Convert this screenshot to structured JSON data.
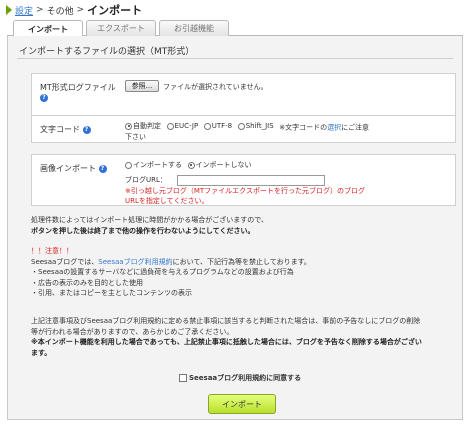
{
  "breadcrumb": {
    "settings": "設定",
    "sep1": ">",
    "other": "その他",
    "sep2": ">",
    "current": "インポート"
  },
  "tabs": [
    {
      "label": "インポート",
      "active": true
    },
    {
      "label": "エクスポート",
      "active": false
    },
    {
      "label": "お引越機能",
      "active": false
    }
  ],
  "section": {
    "title": "インポートするファイルの選択（MT形式）"
  },
  "rows": {
    "mt_log": {
      "label": "MT形式ログファイル",
      "button": "参照...",
      "status": "ファイルが選択されていません。"
    },
    "charset": {
      "label": "文字コード",
      "options": [
        "自動判定",
        "EUC-JP",
        "UTF-8",
        "Shift_JIS"
      ],
      "selected": "自動判定",
      "note_pre": "※文字コードの",
      "note_link": "選択",
      "note_post": "にご注意",
      "note_line2": "下さい"
    },
    "image_import": {
      "label": "画像インポート",
      "options": [
        "インポートする",
        "インポートしない"
      ],
      "selected": "インポートしない",
      "blog_url_label": "ブログURL：",
      "blog_url_value": "",
      "warn_line1": "※引っ越し元ブログ（MTファイルエクスポートを行った元ブログ）のブログ",
      "warn_line2": "URLを指定してください。"
    }
  },
  "notices": {
    "processing_line1": "処理件数によってはインポート処理に時間がかかる場合がございますので、",
    "processing_line2": "ボタンを押した後は終了まで他の操作を行わないようにしてください。",
    "caution_head": "！！注意！！",
    "seesaa_pre": "Seesaaブログでは、",
    "seesaa_link": "Seesaaブログ利用規約",
    "seesaa_post": "において、下記行為等を禁止しております。",
    "bullet1": "・Seesaaの設置するサーバなどに過負荷を与えるプログラムなどの設置および行為",
    "bullet2": "・広告の表示のみを目的とした使用",
    "bullet3": "・引用、またはコピーを主としたコンテンツの表示",
    "terms_line1": "上記注意事項及びSeesaaブログ利用規約に定める禁止事項に該当すると判断された場合は、事前の予告なしにブログの削除",
    "terms_line2": "等が行われる場合がありますので、あらかじめご了承ください。",
    "bold_line1": "※本インポート機能を利用した場合であっても、上記禁止事項に抵触した場合には、ブログを予告なく削除する場合がござい",
    "bold_line2": "ます。"
  },
  "agree_label": "Seesaaブログ利用規約に同意する",
  "import_button": "インポート",
  "colors": {
    "accent_green": "#b7e02b",
    "link_blue": "#3377cc",
    "warning_red": "#d92020"
  }
}
